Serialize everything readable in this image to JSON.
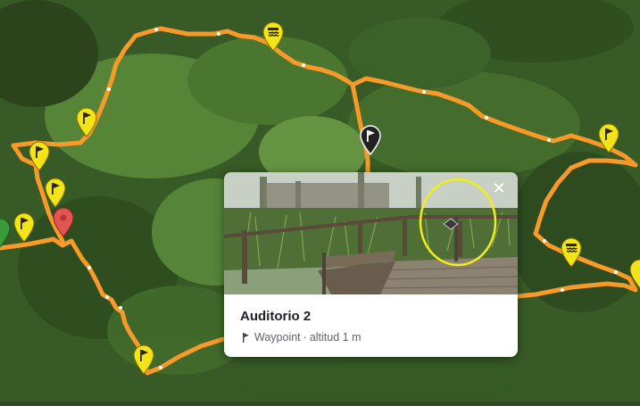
{
  "map": {
    "route_color": "#f79a2a",
    "waypoint_pin_color": "#f2e418",
    "selected_pin_color": "#222222",
    "start_pin_color": "#e25555",
    "end_pin_color": "#3a9a3a",
    "pins": [
      {
        "type": "waterfall-icon",
        "color": "#f2e418"
      },
      {
        "type": "flag-icon",
        "color": "#f2e418"
      },
      {
        "type": "flag-icon",
        "color": "#f2e418"
      },
      {
        "type": "flag-icon",
        "color": "#f2e418"
      },
      {
        "type": "flag-icon",
        "color": "#f2e418"
      },
      {
        "type": "start-pin",
        "color": "#e25555"
      },
      {
        "type": "flag-icon",
        "color": "#3a9a3a"
      },
      {
        "type": "flag-icon",
        "color": "#222222"
      },
      {
        "type": "flag-icon",
        "color": "#f2e418"
      },
      {
        "type": "waterfall-icon",
        "color": "#f2e418"
      },
      {
        "type": "flag-icon",
        "color": "#f2e418"
      },
      {
        "type": "flag-icon",
        "color": "#f2e418"
      }
    ]
  },
  "popup": {
    "title": "Auditorio 2",
    "type_label": "Waypoint",
    "separator": "·",
    "altitude_label": "altitud 1 m",
    "type_icon": "flag-icon",
    "close_icon": "close-icon",
    "highlight_color": "#f1ee18"
  }
}
